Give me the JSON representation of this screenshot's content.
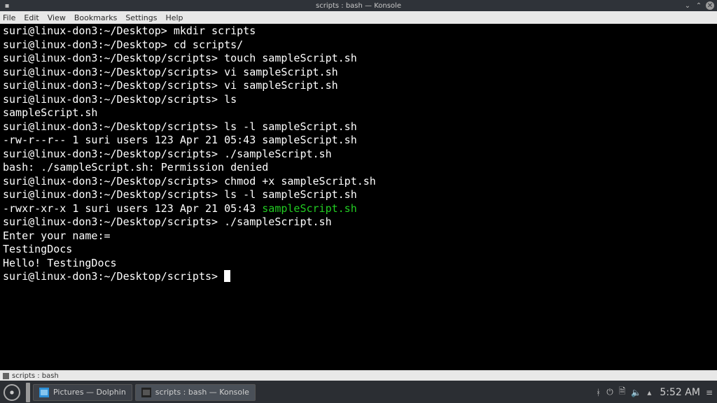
{
  "window": {
    "title": "scripts : bash — Konsole",
    "minimize_label": "⌄",
    "maximize_label": "⌃",
    "close_label": "✕"
  },
  "menubar": {
    "items": [
      "File",
      "Edit",
      "View",
      "Bookmarks",
      "Settings",
      "Help"
    ]
  },
  "terminal": {
    "lines": [
      {
        "prompt": "suri@linux-don3:~/Desktop>",
        "cmd": "mkdir scripts"
      },
      {
        "prompt": "suri@linux-don3:~/Desktop>",
        "cmd": "cd scripts/"
      },
      {
        "prompt": "suri@linux-don3:~/Desktop/scripts>",
        "cmd": "touch sampleScript.sh"
      },
      {
        "prompt": "suri@linux-don3:~/Desktop/scripts>",
        "cmd": "vi sampleScript.sh"
      },
      {
        "prompt": "suri@linux-don3:~/Desktop/scripts>",
        "cmd": "vi sampleScript.sh"
      },
      {
        "prompt": "suri@linux-don3:~/Desktop/scripts>",
        "cmd": "ls"
      },
      {
        "text": "sampleScript.sh"
      },
      {
        "prompt": "suri@linux-don3:~/Desktop/scripts>",
        "cmd": "ls -l sampleScript.sh"
      },
      {
        "text": "-rw-r--r-- 1 suri users 123 Apr 21 05:43 sampleScript.sh"
      },
      {
        "prompt": "suri@linux-don3:~/Desktop/scripts>",
        "cmd": "./sampleScript.sh"
      },
      {
        "text": "bash: ./sampleScript.sh: Permission denied"
      },
      {
        "prompt": "suri@linux-don3:~/Desktop/scripts>",
        "cmd": "chmod +x sampleScript.sh"
      },
      {
        "prompt": "suri@linux-don3:~/Desktop/scripts>",
        "cmd": "ls -l sampleScript.sh"
      },
      {
        "text_pre": "-rwxr-xr-x 1 suri users 123 Apr 21 05:43 ",
        "green": "sampleScript.sh"
      },
      {
        "prompt": "suri@linux-don3:~/Desktop/scripts>",
        "cmd": "./sampleScript.sh"
      },
      {
        "text": "Enter your name:="
      },
      {
        "text": "TestingDocs"
      },
      {
        "text": "Hello! TestingDocs"
      },
      {
        "prompt": "suri@linux-don3:~/Desktop/scripts>",
        "cmd": "",
        "cursor": true
      }
    ]
  },
  "tabbar": {
    "tab_label": "scripts : bash"
  },
  "panel": {
    "tasks": [
      {
        "label": "Pictures — Dolphin",
        "icon_color_a": "#2d8fd6",
        "icon_color_b": "#86c5ee",
        "active": false
      },
      {
        "label": "scripts : bash — Konsole",
        "icon_color_a": "#222",
        "icon_color_b": "#555",
        "active": true
      }
    ],
    "clock": "5:52 AM"
  }
}
